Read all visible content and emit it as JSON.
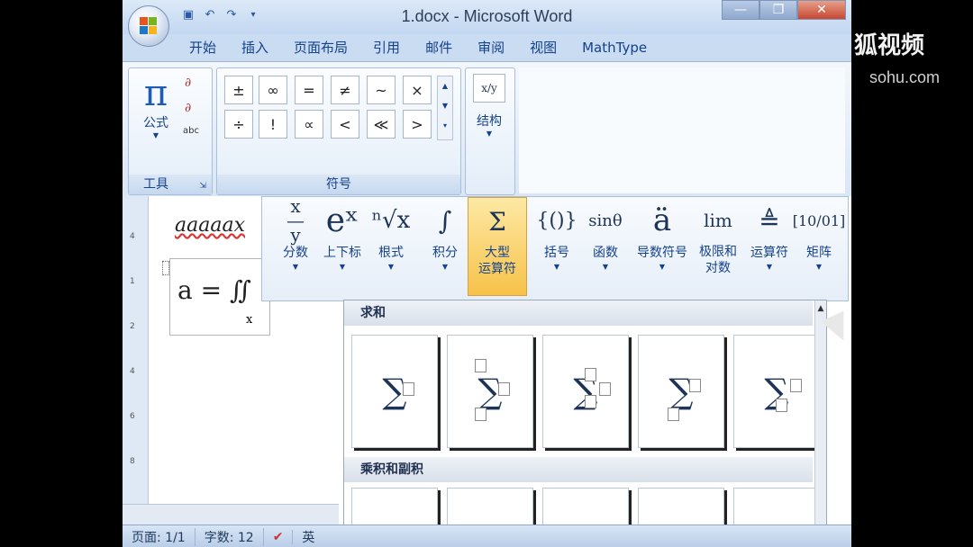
{
  "window": {
    "title": "1.docx - Microsoft Word",
    "controls": [
      "minimize-icon",
      "restore-icon",
      "close-icon"
    ]
  },
  "ribbon_tabs": [
    "开始",
    "插入",
    "页面布局",
    "引用",
    "邮件",
    "审阅",
    "视图",
    "MathType"
  ],
  "tools_group": {
    "equation_label": "公式",
    "label": "工具"
  },
  "symbols_group": {
    "row1": [
      "±",
      "∞",
      "=",
      "≠",
      "~",
      "×"
    ],
    "row2": [
      "÷",
      "!",
      "∝",
      "<",
      "≪",
      ">"
    ],
    "label": "符号"
  },
  "structure_group": {
    "label": "结构"
  },
  "structures": [
    {
      "label": "分数"
    },
    {
      "label": "上下标"
    },
    {
      "label": "根式"
    },
    {
      "label": "积分"
    },
    {
      "label": "大型",
      "label2": "运算符",
      "selected": true
    },
    {
      "label": "括号"
    },
    {
      "label": "函数"
    },
    {
      "label": "导数符号"
    },
    {
      "label": "极限和",
      "label2": "对数"
    },
    {
      "label": "运算符"
    },
    {
      "label": "矩阵"
    }
  ],
  "document": {
    "text_line": "aaaaax",
    "equation": "a = ∬",
    "equation_sub": "x"
  },
  "gallery": {
    "section1": "求和",
    "section2": "乘积和副积"
  },
  "status_bar": {
    "page": "页面: 1/1",
    "words": "字数: 12",
    "lang": "英"
  },
  "watermark": {
    "brand": "狐视频",
    "url": "sohu.com"
  }
}
